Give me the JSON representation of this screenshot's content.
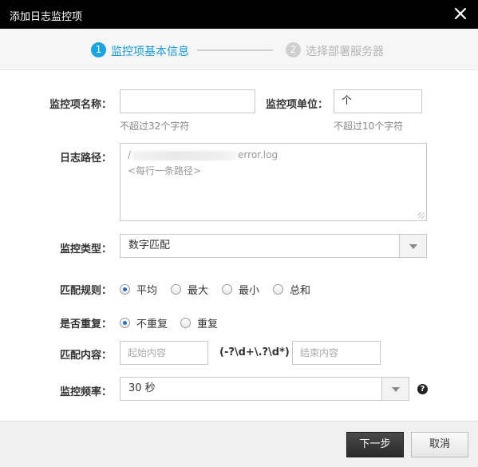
{
  "dialog": {
    "title": "添加日志监控项"
  },
  "steps": [
    {
      "number": "1",
      "label": "监控项基本信息",
      "active": true
    },
    {
      "number": "2",
      "label": "选择部署服务器",
      "active": false
    }
  ],
  "form": {
    "name": {
      "label": "监控项名称：",
      "value": "",
      "hint": "不超过32个字符"
    },
    "unit": {
      "label": "监控项单位：",
      "value": "个",
      "hint": "不超过10个字符"
    },
    "log_path": {
      "label": "日志路径：",
      "value_prefix": "/",
      "value_suffix": "error.log",
      "placeholder": "<每行一条路径>"
    },
    "monitor_type": {
      "label": "监控类型：",
      "value": "数字匹配"
    },
    "match_rule": {
      "label": "匹配规则：",
      "options": [
        "平均",
        "最大",
        "最小",
        "总和"
      ],
      "selected": "平均"
    },
    "repeat": {
      "label": "是否重复：",
      "options": [
        "不重复",
        "重复"
      ],
      "selected": "不重复"
    },
    "match_content": {
      "label": "匹配内容：",
      "start_placeholder": "起始内容",
      "regex": "(-?\\d+\\.?\\d*)",
      "end_placeholder": "结束内容"
    },
    "frequency": {
      "label": "监控频率：",
      "value": "30 秒"
    }
  },
  "footer": {
    "next_label": "下一步",
    "cancel_label": "取消"
  },
  "colors": {
    "accent": "#1aa3e0",
    "titlebar": "#000000"
  }
}
